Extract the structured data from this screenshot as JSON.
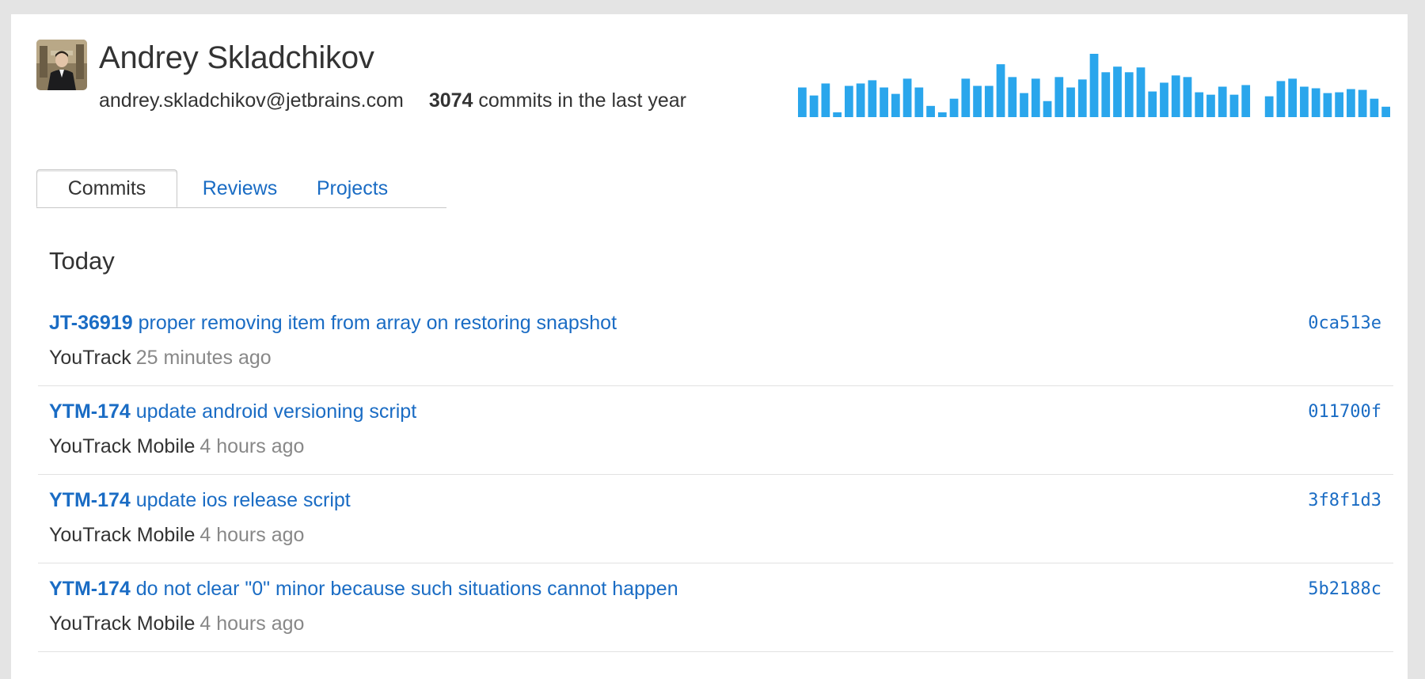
{
  "user": {
    "name": "Andrey Skladchikov",
    "email": "andrey.skladchikov@jetbrains.com",
    "commit_count": "3074",
    "commit_count_suffix": "commits in the last year"
  },
  "activity_chart": {
    "color": "#2aa6ec",
    "values": [
      37,
      27,
      42,
      6,
      39,
      42,
      46,
      37,
      29,
      48,
      37,
      14,
      6,
      23,
      48,
      39,
      39,
      66,
      50,
      30,
      48,
      20,
      50,
      37,
      47,
      79,
      56,
      63,
      56,
      62,
      32,
      43,
      52,
      50,
      31,
      28,
      38,
      28,
      40,
      0,
      26,
      45,
      48,
      38,
      36,
      30,
      31,
      35,
      34,
      23,
      13
    ]
  },
  "tabs": [
    {
      "label": "Commits",
      "active": true
    },
    {
      "label": "Reviews",
      "active": false
    },
    {
      "label": "Projects",
      "active": false
    }
  ],
  "section": {
    "title": "Today"
  },
  "commits": [
    {
      "issue": "JT-36919",
      "message": "proper removing item from array on restoring snapshot",
      "hash": "0ca513e",
      "project": "YouTrack",
      "time": "25 minutes ago"
    },
    {
      "issue": "YTM-174",
      "message": "update android versioning script",
      "hash": "011700f",
      "project": "YouTrack Mobile",
      "time": "4 hours ago"
    },
    {
      "issue": "YTM-174",
      "message": "update ios release script",
      "hash": "3f8f1d3",
      "project": "YouTrack Mobile",
      "time": "4 hours ago"
    },
    {
      "issue": "YTM-174",
      "message": "do not clear \"0\" minor because such situations cannot happen",
      "hash": "5b2188c",
      "project": "YouTrack Mobile",
      "time": "4 hours ago"
    }
  ]
}
